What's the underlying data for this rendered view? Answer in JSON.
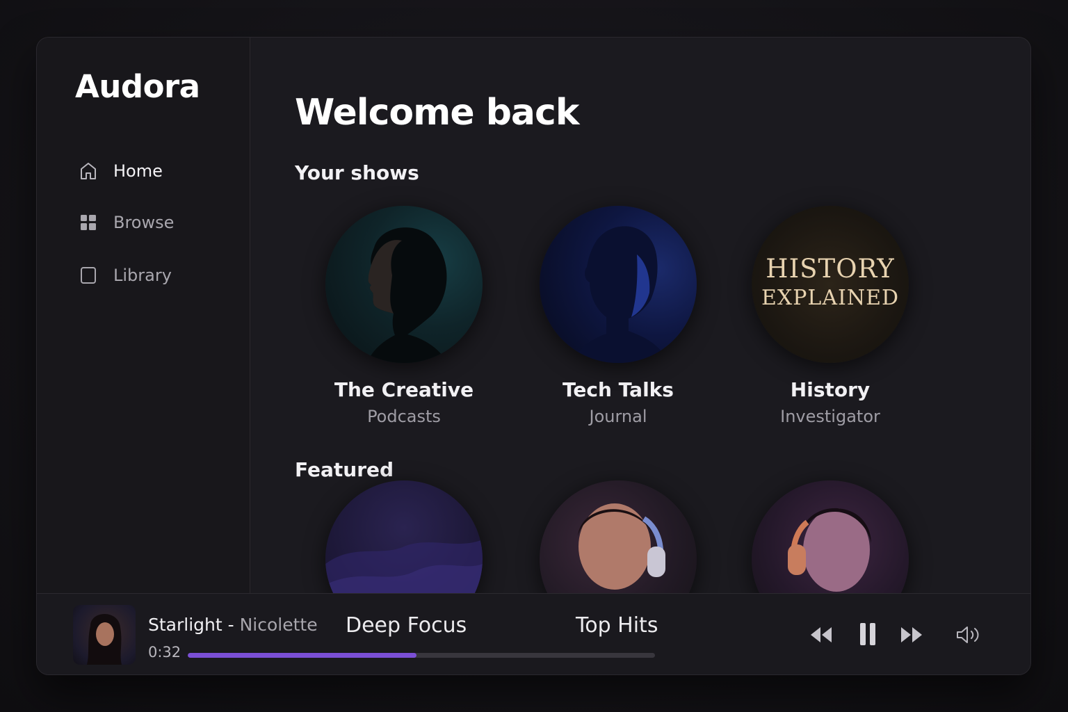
{
  "app": {
    "name": "Audora"
  },
  "sidebar": {
    "items": [
      {
        "label": "Home",
        "icon": "home-icon",
        "active": true
      },
      {
        "label": "Browse",
        "icon": "grid-icon",
        "active": false
      },
      {
        "label": "Library",
        "icon": "library-icon",
        "active": false
      }
    ]
  },
  "main": {
    "welcome": "Welcome back",
    "your_shows": {
      "title": "Your shows",
      "items": [
        {
          "title": "The Creative",
          "subtitle": "Podcasts"
        },
        {
          "title": "Tech Talks",
          "subtitle": "Journal"
        },
        {
          "title": "History",
          "subtitle": "Investigator",
          "art_line1": "HISTORY",
          "art_line2": "EXPLAINED"
        }
      ]
    },
    "featured": {
      "title": "Featured"
    }
  },
  "player": {
    "track": "Starlight",
    "separator": " - ",
    "artist": "Nicolette",
    "elapsed": "0:32",
    "progress": 0.49,
    "playlists": [
      "Deep Focus",
      "Top Hits"
    ],
    "controls": [
      "rewind-icon",
      "pause-icon",
      "fast-forward-icon",
      "volume-icon"
    ]
  },
  "colors": {
    "accent": "#7b4fd6",
    "background": "#1b1a1f",
    "sidebar": "#18171b",
    "history_text": "#e8d3b0"
  }
}
